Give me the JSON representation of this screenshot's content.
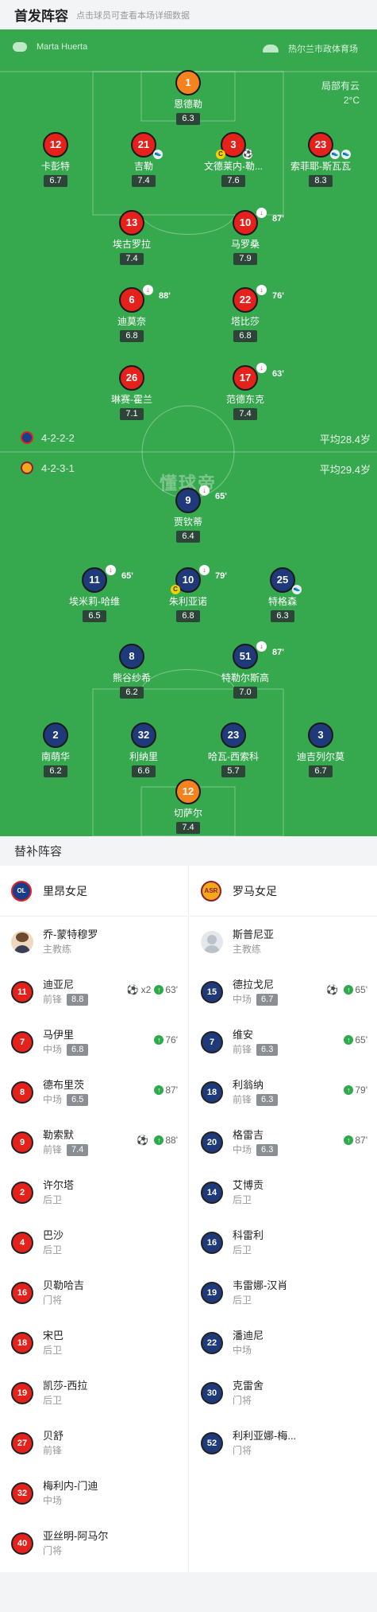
{
  "header": {
    "title": "首发阵容",
    "subtitle": "点击球员可查看本场详细数据"
  },
  "pitch": {
    "referee": "Marta Huerta",
    "stadium": "热尔兰市政体育场",
    "weather": {
      "condition": "局部有云",
      "temp": "2°C"
    },
    "watermark": "懂球帝",
    "home": {
      "formation": "4-2-2-2",
      "avg_age": "平均28.4岁",
      "color": "#e5211b"
    },
    "away": {
      "formation": "4-2-3-1",
      "avg_age": "平均29.4岁",
      "color": "#1f3a7a"
    },
    "players": [
      {
        "num": "1",
        "name": "恩德勒",
        "rating": "6.3",
        "kit": "orange"
      },
      {
        "num": "12",
        "name": "卡彭特",
        "rating": "6.7",
        "kit": "red"
      },
      {
        "num": "21",
        "name": "吉勒",
        "rating": "7.4",
        "kit": "red"
      },
      {
        "num": "3",
        "name": "文德莱内-勒...",
        "rating": "7.6",
        "kit": "red"
      },
      {
        "num": "23",
        "name": "索菲耶-斯瓦瓦",
        "rating": "8.3",
        "kit": "red"
      },
      {
        "num": "13",
        "name": "埃古罗拉",
        "rating": "7.4",
        "kit": "red"
      },
      {
        "num": "10",
        "name": "马罗桑",
        "rating": "7.9",
        "kit": "red",
        "sub": "87'"
      },
      {
        "num": "6",
        "name": "迪莫奈",
        "rating": "6.8",
        "kit": "red",
        "sub": "88'"
      },
      {
        "num": "22",
        "name": "塔比莎",
        "rating": "6.8",
        "kit": "red",
        "sub": "76'"
      },
      {
        "num": "26",
        "name": "琳赛-霍兰",
        "rating": "7.1",
        "kit": "red"
      },
      {
        "num": "17",
        "name": "范德东克",
        "rating": "7.4",
        "kit": "red",
        "sub": "63'"
      },
      {
        "num": "9",
        "name": "贾钦蒂",
        "rating": "6.4",
        "kit": "navy",
        "sub": "65'"
      },
      {
        "num": "11",
        "name": "埃米莉-哈维",
        "rating": "6.5",
        "kit": "navy",
        "sub": "65'"
      },
      {
        "num": "10",
        "name": "朱利亚诺",
        "rating": "6.8",
        "kit": "navy",
        "sub": "79'"
      },
      {
        "num": "25",
        "name": "特格森",
        "rating": "6.3",
        "kit": "navy"
      },
      {
        "num": "8",
        "name": "熊谷纱希",
        "rating": "6.2",
        "kit": "navy"
      },
      {
        "num": "51",
        "name": "特勒尔斯高",
        "rating": "7.0",
        "kit": "navy",
        "sub": "87'"
      },
      {
        "num": "2",
        "name": "南萌华",
        "rating": "6.2",
        "kit": "navy"
      },
      {
        "num": "32",
        "name": "利纳里",
        "rating": "6.6",
        "kit": "navy"
      },
      {
        "num": "23",
        "name": "哈瓦-西索科",
        "rating": "5.7",
        "kit": "navy"
      },
      {
        "num": "3",
        "name": "迪吉列尔莫",
        "rating": "6.7",
        "kit": "navy"
      },
      {
        "num": "12",
        "name": "切萨尔",
        "rating": "7.4",
        "kit": "orange"
      }
    ]
  },
  "bench": {
    "title": "替补阵容",
    "home": {
      "team": "里昂女足",
      "logo_text": "OL",
      "coach": {
        "name": "乔-蒙特穆罗",
        "role": "主教练"
      },
      "players": [
        {
          "num": "11",
          "name": "迪亚尼",
          "pos": "前锋",
          "rating": "8.8",
          "goals": "x2",
          "sub": "63'"
        },
        {
          "num": "7",
          "name": "马伊里",
          "pos": "中场",
          "rating": "6.8",
          "sub": "76'"
        },
        {
          "num": "8",
          "name": "德布里茨",
          "pos": "中场",
          "rating": "6.5",
          "sub": "87'"
        },
        {
          "num": "9",
          "name": "勒索默",
          "pos": "前锋",
          "rating": "7.4",
          "goal": "⚽",
          "sub": "88'"
        },
        {
          "num": "2",
          "name": "许尔塔",
          "pos": "后卫"
        },
        {
          "num": "4",
          "name": "巴沙",
          "pos": "后卫"
        },
        {
          "num": "16",
          "name": "贝勒哈吉",
          "pos": "门将"
        },
        {
          "num": "18",
          "name": "宋巴",
          "pos": "后卫"
        },
        {
          "num": "19",
          "name": "凯莎-西拉",
          "pos": "后卫"
        },
        {
          "num": "27",
          "name": "贝舒",
          "pos": "前锋"
        },
        {
          "num": "32",
          "name": "梅利内-门迪",
          "pos": "中场"
        },
        {
          "num": "40",
          "name": "亚丝明-阿马尔",
          "pos": "门将"
        }
      ]
    },
    "away": {
      "team": "罗马女足",
      "logo_text": "ASR",
      "coach": {
        "name": "斯普尼亚",
        "role": "主教练"
      },
      "players": [
        {
          "num": "15",
          "name": "德拉戈尼",
          "pos": "中场",
          "rating": "6.7",
          "goal": "⚽",
          "sub": "65'"
        },
        {
          "num": "7",
          "name": "维安",
          "pos": "前锋",
          "rating": "6.3",
          "sub": "65'"
        },
        {
          "num": "18",
          "name": "利翁纳",
          "pos": "前锋",
          "rating": "6.3",
          "sub": "79'"
        },
        {
          "num": "20",
          "name": "格雷吉",
          "pos": "中场",
          "rating": "6.3",
          "sub": "87'"
        },
        {
          "num": "14",
          "name": "艾博贡",
          "pos": "后卫"
        },
        {
          "num": "16",
          "name": "科雷利",
          "pos": "后卫"
        },
        {
          "num": "19",
          "name": "韦雷娜-汉肖",
          "pos": "后卫"
        },
        {
          "num": "22",
          "name": "潘迪尼",
          "pos": "中场"
        },
        {
          "num": "30",
          "name": "克雷舍",
          "pos": "门将"
        },
        {
          "num": "52",
          "name": "利利亚娜-梅...",
          "pos": "门将"
        }
      ]
    }
  }
}
